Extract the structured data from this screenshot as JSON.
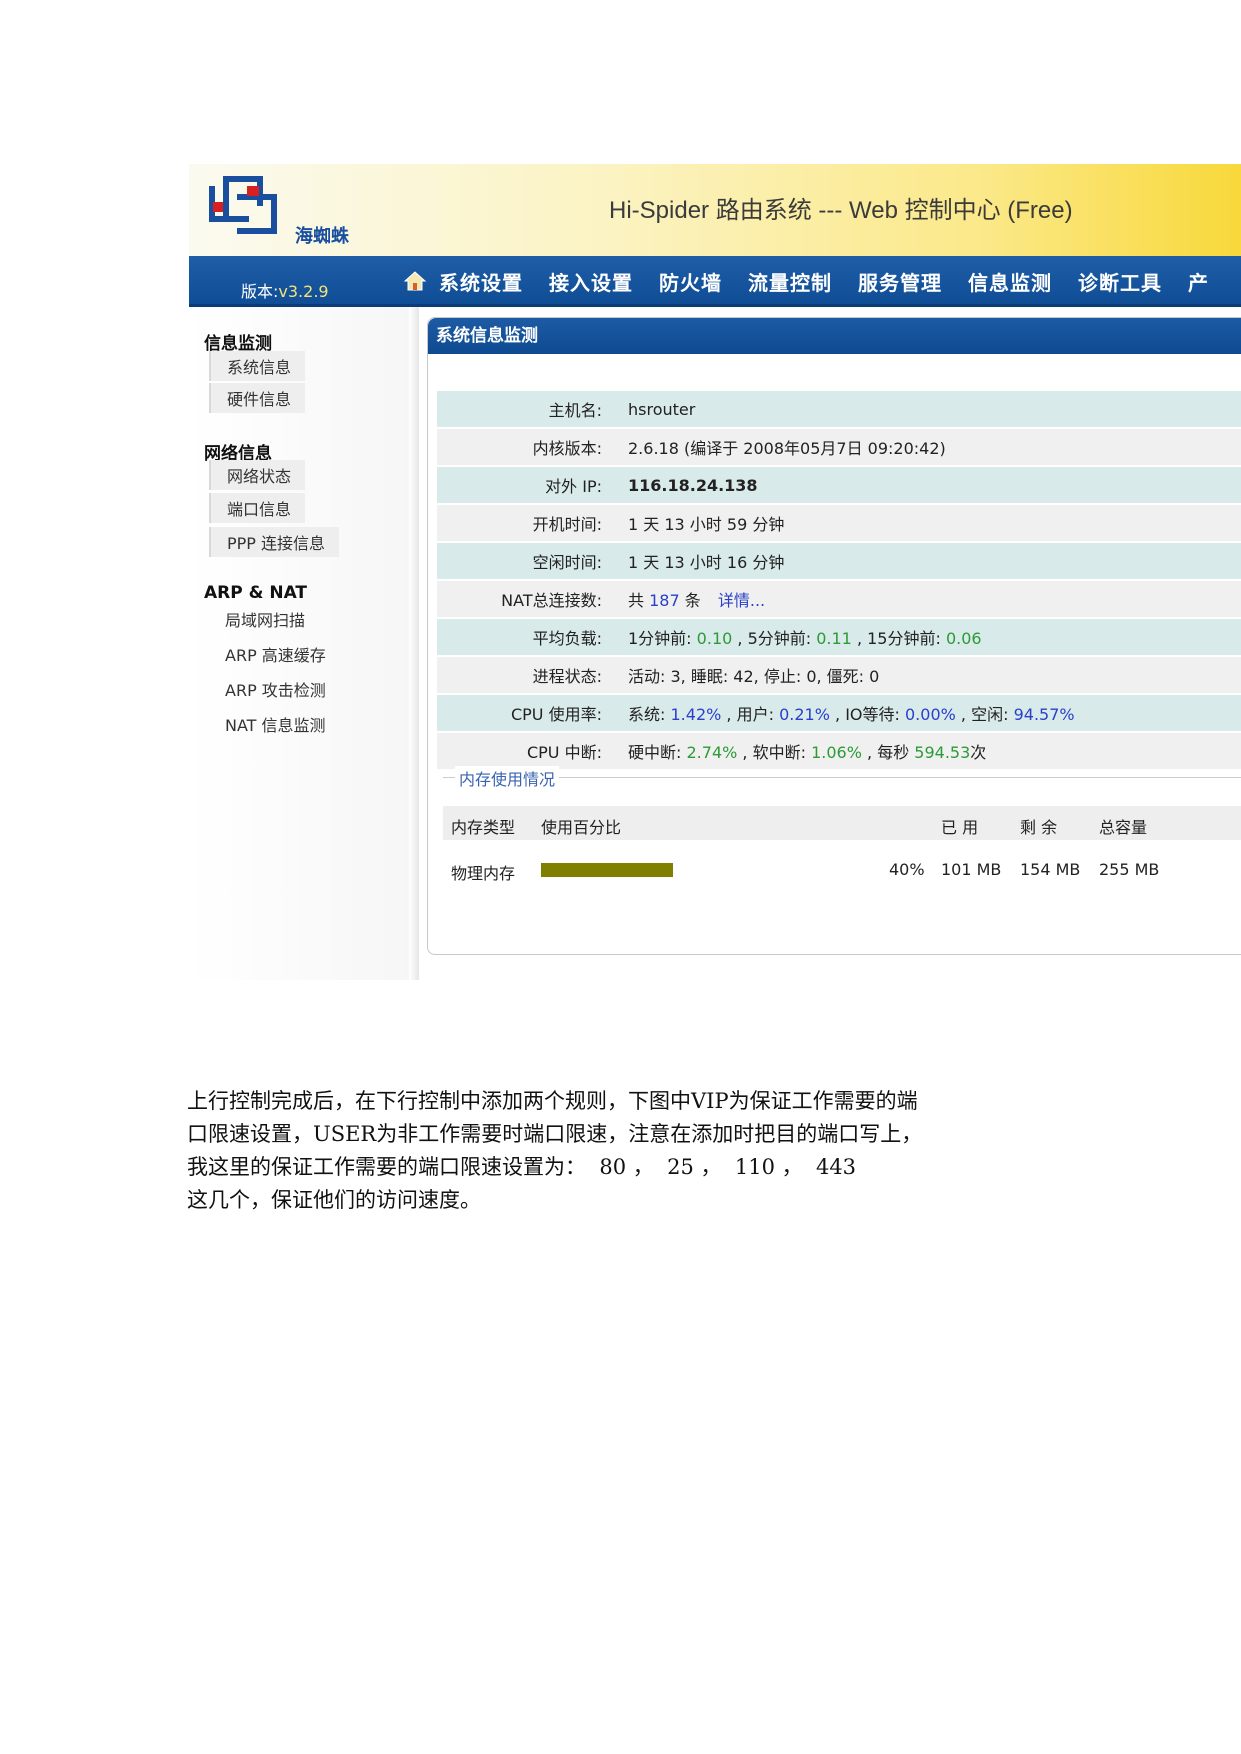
{
  "header": {
    "logo_text": "海蜘蛛",
    "title": "Hi-Spider 路由系统 --- Web 控制中心 (Free)"
  },
  "navbar": {
    "version_label": "版本:",
    "version_value": "v3.2.9",
    "items": [
      "系统设置",
      "接入设置",
      "防火墙",
      "流量控制",
      "服务管理",
      "信息监测",
      "诊断工具",
      "产"
    ]
  },
  "sidebar": {
    "groups": [
      {
        "title": "信息监测",
        "items": [
          "系统信息",
          "硬件信息"
        ]
      },
      {
        "title": "网络信息",
        "items": [
          "网络状态",
          "端口信息",
          "PPP 连接信息"
        ]
      },
      {
        "title": "ARP & NAT",
        "items": [
          "局域网扫描",
          "ARP 高速缓存",
          "ARP 攻击检测",
          "NAT 信息监测"
        ]
      }
    ]
  },
  "panel": {
    "title": "系统信息监测",
    "rows": {
      "hostname": {
        "label": "主机名:",
        "value": "hsrouter"
      },
      "kernel": {
        "label": "内核版本:",
        "value": "2.6.18 (编译于 2008年05月7日 09:20:42)"
      },
      "ip": {
        "label": "对外 IP:",
        "value": "116.18.24.138"
      },
      "uptime": {
        "label": "开机时间:",
        "value": "1 天 13 小时 59 分钟"
      },
      "idle": {
        "label": "空闲时间:",
        "value": "1 天 13 小时 16 分钟"
      },
      "nat": {
        "label": "NAT总连接数:",
        "prefix": "共",
        "count": "187",
        "suffix": "条",
        "link": "详情..."
      },
      "load": {
        "label": "平均负载:",
        "l1_label": "1分钟前:",
        "l1": "0.10",
        "l5_label": "5分钟前:",
        "l5": "0.11",
        "l15_label": "15分钟前:",
        "l15": "0.06"
      },
      "proc": {
        "label": "进程状态:",
        "value": "活动: 3, 睡眠: 42, 停止: 0, 僵死: 0"
      },
      "cpu": {
        "label": "CPU 使用率:",
        "sys_label": "系统:",
        "sys": "1.42%",
        "user_label": "用户:",
        "user": "0.21%",
        "io_label": "IO等待:",
        "io": "0.00%",
        "idle_label": "空闲:",
        "idle": "94.57%"
      },
      "irq": {
        "label": "CPU 中断:",
        "hard_label": "硬中断:",
        "hard": "2.74%",
        "soft_label": "软中断:",
        "soft": "1.06%",
        "rate_label": "每秒",
        "rate": "594.53",
        "rate_unit": "次"
      }
    },
    "memory": {
      "legend": "内存使用情况",
      "headers": [
        "内存类型",
        "使用百分比",
        "已 用",
        "剩 余",
        "总容量"
      ],
      "row": {
        "type": "物理内存",
        "percent": "40%",
        "used": "101 MB",
        "free": "154 MB",
        "total": "255 MB",
        "bar_fraction": 0.4,
        "bar_color": "#808000"
      }
    }
  },
  "document": {
    "lines": [
      "上行控制完成后，在下行控制中添加两个规则，下图中VIP为保证工作需要的端",
      "口限速设置，USER为非工作需要时端口限速，注意在添加时把目的端口写上，",
      "我这里的保证工作需要的端口限速设置为：  80 ，  25 ，  110 ，  443",
      "这几个，保证他们的访问速度。"
    ]
  }
}
